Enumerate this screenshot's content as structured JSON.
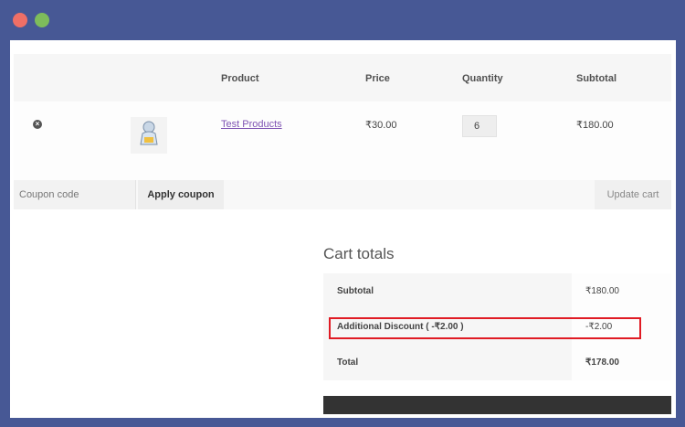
{
  "window": {
    "controls": [
      "close-dot",
      "maximize-dot"
    ]
  },
  "cart": {
    "headers": {
      "product": "Product",
      "price": "Price",
      "quantity": "Quantity",
      "subtotal": "Subtotal"
    },
    "item": {
      "remove_icon": "×",
      "product_name": "Test Products",
      "price": "₹30.00",
      "quantity": "6",
      "subtotal": "₹180.00"
    },
    "actions": {
      "coupon_placeholder": "Coupon code",
      "apply_label": "Apply coupon",
      "update_label": "Update cart"
    }
  },
  "totals": {
    "title": "Cart totals",
    "rows": [
      {
        "label": "Subtotal",
        "value": "₹180.00"
      },
      {
        "label": "Additional Discount ( -₹2.00 )",
        "value": "-₹2.00"
      },
      {
        "label": "Total",
        "value": "₹178.00"
      }
    ]
  },
  "colors": {
    "background": "#475895",
    "link": "#7f54b3",
    "highlight": "#e01b24"
  }
}
